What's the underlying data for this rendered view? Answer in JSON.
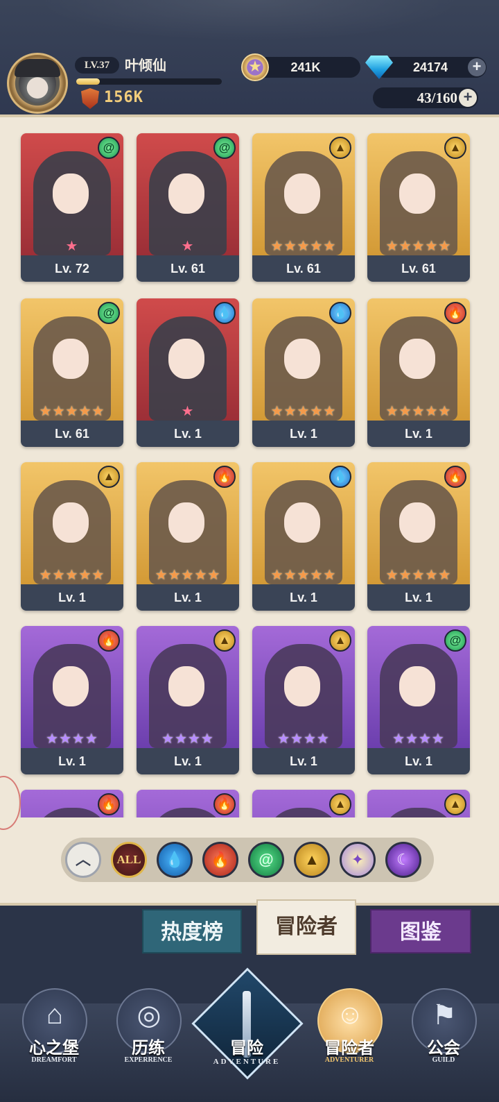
{
  "player": {
    "level": "LV.37",
    "name": "叶倾仙",
    "exp_fraction": 0.16,
    "power": "156K"
  },
  "currency": {
    "gold": "241K",
    "gems": "24174",
    "roster_count": "43/160"
  },
  "heroes": [
    {
      "level": "Lv. 72",
      "stars": "★",
      "star_color": "pink",
      "element": "wind",
      "bg": "red"
    },
    {
      "level": "Lv. 61",
      "stars": "★",
      "star_color": "pink",
      "element": "wind",
      "bg": "red"
    },
    {
      "level": "Lv. 61",
      "stars": "★★★★★",
      "star_color": "orange",
      "element": "earth",
      "bg": "gold"
    },
    {
      "level": "Lv. 61",
      "stars": "★★★★★",
      "star_color": "orange",
      "element": "earth",
      "bg": "gold"
    },
    {
      "level": "Lv. 61",
      "stars": "★★★★★",
      "star_color": "orange",
      "element": "wind",
      "bg": "gold"
    },
    {
      "level": "Lv. 1",
      "stars": "★",
      "star_color": "pink",
      "element": "water",
      "bg": "red"
    },
    {
      "level": "Lv. 1",
      "stars": "★★★★★",
      "star_color": "orange",
      "element": "water",
      "bg": "gold"
    },
    {
      "level": "Lv. 1",
      "stars": "★★★★★",
      "star_color": "orange",
      "element": "fire",
      "bg": "gold"
    },
    {
      "level": "Lv. 1",
      "stars": "★★★★★",
      "star_color": "orange",
      "element": "earth",
      "bg": "gold"
    },
    {
      "level": "Lv. 1",
      "stars": "★★★★★",
      "star_color": "orange",
      "element": "fire",
      "bg": "gold"
    },
    {
      "level": "Lv. 1",
      "stars": "★★★★★",
      "star_color": "orange",
      "element": "water",
      "bg": "gold"
    },
    {
      "level": "Lv. 1",
      "stars": "★★★★★",
      "star_color": "orange",
      "element": "fire",
      "bg": "gold"
    },
    {
      "level": "Lv. 1",
      "stars": "★★★★",
      "star_color": "purple",
      "element": "fire",
      "bg": "purple"
    },
    {
      "level": "Lv. 1",
      "stars": "★★★★",
      "star_color": "purple",
      "element": "earth",
      "bg": "purple"
    },
    {
      "level": "Lv. 1",
      "stars": "★★★★",
      "star_color": "purple",
      "element": "earth",
      "bg": "purple"
    },
    {
      "level": "Lv. 1",
      "stars": "★★★★",
      "star_color": "purple",
      "element": "wind",
      "bg": "purple"
    },
    {
      "level": "",
      "stars": "",
      "star_color": "orange",
      "element": "fire",
      "bg": "purple"
    },
    {
      "level": "",
      "stars": "",
      "star_color": "orange",
      "element": "fire",
      "bg": "purple"
    },
    {
      "level": "",
      "stars": "",
      "star_color": "orange",
      "element": "earth",
      "bg": "purple"
    },
    {
      "level": "",
      "stars": "",
      "star_color": "orange",
      "element": "earth",
      "bg": "purple"
    }
  ],
  "element_icons": {
    "wind": "wind-icon",
    "earth": "earth-icon",
    "water": "water-icon",
    "fire": "fire-icon"
  },
  "filters": {
    "collapse": "︿",
    "all": "ALL",
    "water": "💧",
    "fire": "🔥",
    "wind": "@",
    "earth": "▲",
    "light": "✦",
    "dark": "☾"
  },
  "tabs": {
    "hot": "热度榜",
    "adventurer": "冒险者",
    "guide": "图鉴"
  },
  "nav": {
    "dreamfort": {
      "title": "心之堡",
      "sub": "DREAMFORT"
    },
    "experience": {
      "title": "历练",
      "sub": "EXPERRENCE"
    },
    "adventure": {
      "title": "冒险",
      "sub": "ADVENTURE"
    },
    "adventurer": {
      "title": "冒险者",
      "sub": "ADVENTURER"
    },
    "guild": {
      "title": "公会",
      "sub": "GUILD"
    }
  },
  "colors": {
    "accent_gold": "#f3cd7b",
    "panel_bg": "#efe7d8",
    "nav_bg": "#2b3448"
  }
}
